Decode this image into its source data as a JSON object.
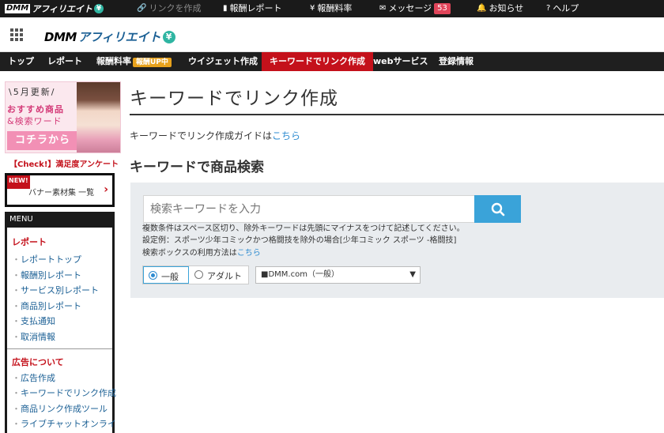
{
  "topbar": {
    "logo_dmm": "DMM",
    "logo_aff": "アフィリエイト",
    "logo_yen": "¥",
    "items": [
      {
        "label": "リンクを作成",
        "icon": "link-icon"
      },
      {
        "label": "報酬レポート",
        "icon": "bar-chart-icon"
      },
      {
        "label": "報酬料率",
        "icon": "yen-icon"
      },
      {
        "label": "メッセージ",
        "icon": "envelope-icon",
        "badge": "53"
      },
      {
        "label": "お知らせ",
        "icon": "bell-icon"
      },
      {
        "label": "ヘルプ",
        "icon": "question-icon"
      }
    ]
  },
  "header": {
    "logo_dmm": "DMM",
    "logo_aff": "アフィリエイト",
    "logo_yen": "¥"
  },
  "nav": {
    "items": [
      "トップ",
      "レポート",
      "報酬料率",
      "ウイジェット作成",
      "キーワードでリンク作成",
      "webサービス",
      "登録情報"
    ],
    "badge": "報酬UP中",
    "active_index": 4
  },
  "sidebar": {
    "banner": {
      "line1": "\\5月更新/",
      "line2": "おすすめ商品",
      "line3": "&検索ワード",
      "cta": "コチラから"
    },
    "check_text": "【Check!】満足度アンケート",
    "new_label": "NEW!",
    "banner_link": "バナー素材集 一覧",
    "menu_title": "MENU",
    "sections": [
      {
        "title": "レポート",
        "items": [
          "レポートトップ",
          "報酬別レポート",
          "サービス別レポート",
          "商品別レポート",
          "支払通知",
          "取消情報"
        ]
      },
      {
        "title": "広告について",
        "items": [
          "広告作成",
          "キーワードでリンク作成",
          "商品リンク作成ツール",
          "ライブチャットオンライ"
        ]
      }
    ]
  },
  "main": {
    "page_title": "キーワードでリンク作成",
    "guide_text": "キーワードでリンク作成ガイドは",
    "guide_link": "こちら",
    "sub_title": "キーワードで商品検索",
    "search_placeholder": "検索キーワードを入力",
    "help_line1": "複数条件はスペース区切り、除外キーワードは先頭にマイナスをつけて記述してください。",
    "help_line2": "設定例：スポーツ少年コミックかつ格闘技を除外の場合[少年コミック スポーツ -格闘技]",
    "help_line3": "検索ボックスの利用方法は",
    "help_link": "こちら",
    "radio_general": "一般",
    "radio_adult": "アダルト",
    "select_value": "■DMM.com（一般）"
  }
}
